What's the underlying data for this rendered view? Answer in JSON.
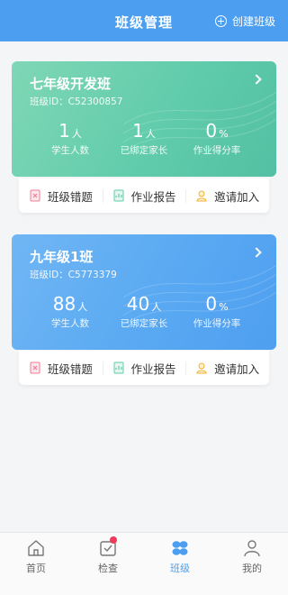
{
  "header": {
    "title": "班级管理",
    "create_label": "创建班级"
  },
  "classes": [
    {
      "name": "七年级开发班",
      "id_text": "班级ID：C52300857",
      "stats": [
        {
          "value": "1",
          "unit": "人",
          "label": "学生人数"
        },
        {
          "value": "1",
          "unit": "人",
          "label": "已绑定家长"
        },
        {
          "value": "0",
          "unit": "%",
          "label": "作业得分率"
        }
      ],
      "actions": [
        {
          "label": "班级错题",
          "icon": "wrong-questions-icon"
        },
        {
          "label": "作业报告",
          "icon": "homework-report-icon"
        },
        {
          "label": "邀请加入",
          "icon": "invite-icon"
        }
      ]
    },
    {
      "name": "九年级1班",
      "id_text": "班级ID：C5773379",
      "stats": [
        {
          "value": "88",
          "unit": "人",
          "label": "学生人数"
        },
        {
          "value": "40",
          "unit": "人",
          "label": "已绑定家长"
        },
        {
          "value": "0",
          "unit": "%",
          "label": "作业得分率"
        }
      ],
      "actions": [
        {
          "label": "班级错题",
          "icon": "wrong-questions-icon"
        },
        {
          "label": "作业报告",
          "icon": "homework-report-icon"
        },
        {
          "label": "邀请加入",
          "icon": "invite-icon"
        }
      ]
    }
  ],
  "tabs": [
    {
      "label": "首页",
      "icon": "home-icon"
    },
    {
      "label": "检查",
      "icon": "check-icon"
    },
    {
      "label": "班级",
      "icon": "class-icon"
    },
    {
      "label": "我的",
      "icon": "profile-icon"
    }
  ],
  "colors": {
    "accent": "#4c9ff0",
    "green_card": "#5fcbaa",
    "blue_card": "#58a8f2",
    "badge": "#ee3b5a"
  }
}
